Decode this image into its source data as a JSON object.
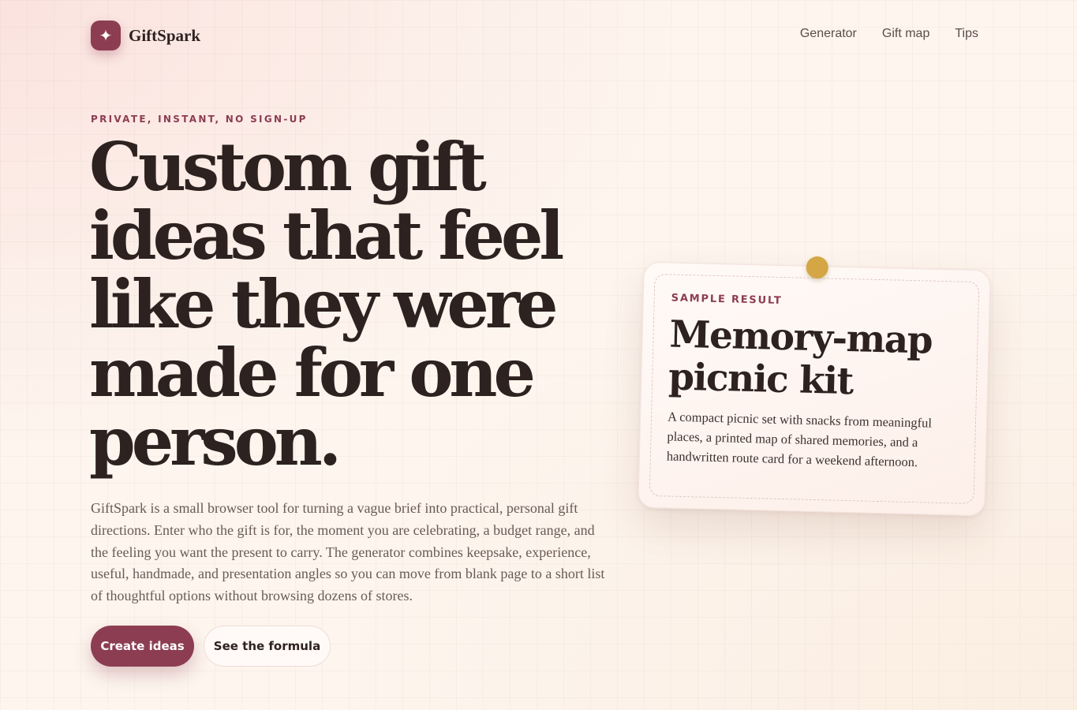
{
  "brand": {
    "logo_icon": "sparkle-icon",
    "logo_glyph": "✦",
    "name": "GiftSpark"
  },
  "nav": {
    "items": [
      "Generator",
      "Gift map",
      "Tips"
    ]
  },
  "hero": {
    "eyebrow": "PRIVATE, INSTANT, NO SIGN-UP",
    "headline": "Custom gift ideas that feel like they were made for one person.",
    "intro": "GiftSpark is a small browser tool for turning a vague brief into practical, personal gift directions. Enter who the gift is for, the moment you are celebrating, a budget range, and the feeling you want the present to carry. The generator combines keepsake, experience, useful, handmade, and presentation angles so you can move from blank page to a short list of thoughtful options without browsing dozens of stores.",
    "primary_button": "Create ideas",
    "secondary_button": "See the formula"
  },
  "sample_card": {
    "label": "SAMPLE RESULT",
    "title": "Memory-map picnic kit",
    "description": "A compact picnic set with snacks from meaningful places, a printed map of shared memories, and a handwritten route card for a weekend afternoon."
  },
  "colors": {
    "accent": "#8c3d52",
    "pin": "#d4a645",
    "text": "#2d221f",
    "background": "#fdf5ee"
  }
}
